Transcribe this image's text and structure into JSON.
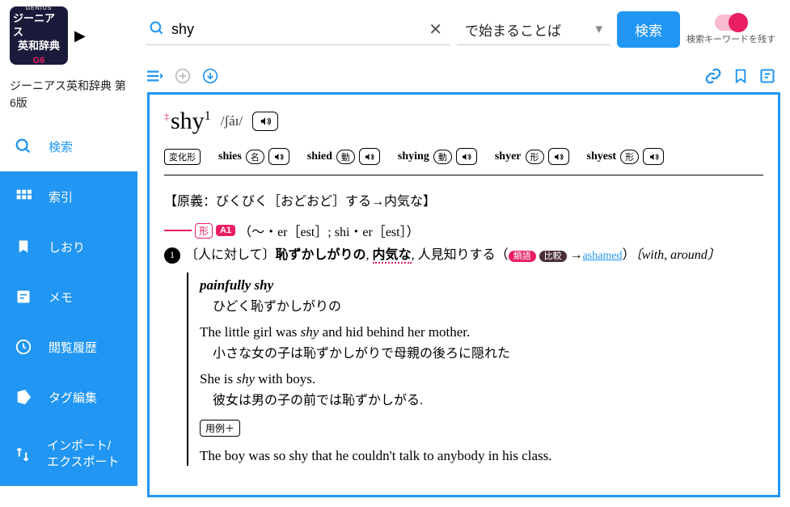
{
  "sidebar": {
    "logo": {
      "l1": "GENIUS",
      "l2": "ジーニアス",
      "l3": "英和辞典",
      "l4": "G6"
    },
    "dict_title": "ジーニアス英和辞典 第6版",
    "items": [
      {
        "label": "検索",
        "icon": "search"
      },
      {
        "label": "索引",
        "icon": "grid"
      },
      {
        "label": "しおり",
        "icon": "bookmark"
      },
      {
        "label": "メモ",
        "icon": "note"
      },
      {
        "label": "閲覧履歴",
        "icon": "history"
      },
      {
        "label": "タグ編集",
        "icon": "tag"
      },
      {
        "label": "インポート/エクスポート",
        "icon": "import-export"
      }
    ]
  },
  "search": {
    "value": "shy",
    "mode": "で始まることば",
    "button": "検索",
    "toggle_label": "検索キーワードを残す"
  },
  "entry": {
    "headword": "shy",
    "hw_sup": "1",
    "pronunciation": "/ʃáɪ/",
    "inflect_label": "変化形",
    "inflections": [
      {
        "form": "shies",
        "pos": "名"
      },
      {
        "form": "shied",
        "pos": "動"
      },
      {
        "form": "shying",
        "pos": "動"
      },
      {
        "form": "shyer",
        "pos": "形"
      },
      {
        "form": "shyest",
        "pos": "形"
      }
    ],
    "origin": "【原義：びくびく［おどおど］する→内気な】",
    "sense_head": {
      "pos": "形",
      "level": "A1",
      "comp": "（～・er［est］; shi・er［est］）"
    },
    "sense1": {
      "num": "❶",
      "prefix": "〔人に対して〕",
      "bold1": "恥ずかしがりの",
      "comma": ", ",
      "bold2": "内気な",
      "tail": ", 人見知りする（",
      "chip1": "類語",
      "chip2": "比較",
      "arrow": " →",
      "link": "ashamed",
      "close": "）",
      "collocation": "〔with, around〕"
    },
    "examples": [
      {
        "en": "painfully shy",
        "jp": "ひどく恥ずかしがりの"
      },
      {
        "en_html": "The little girl was <i>shy</i> and hid behind her mother.",
        "jp": "小さな女の子は恥ずかしがりで母親の後ろに隠れた"
      },
      {
        "en_html": "She is <i>shy</i> with boys.",
        "jp": "彼女は男の子の前では恥ずかしがる."
      }
    ],
    "more_ex": "用例＋",
    "example4": "The boy was so shy that he couldn't talk to anybody in his class."
  }
}
